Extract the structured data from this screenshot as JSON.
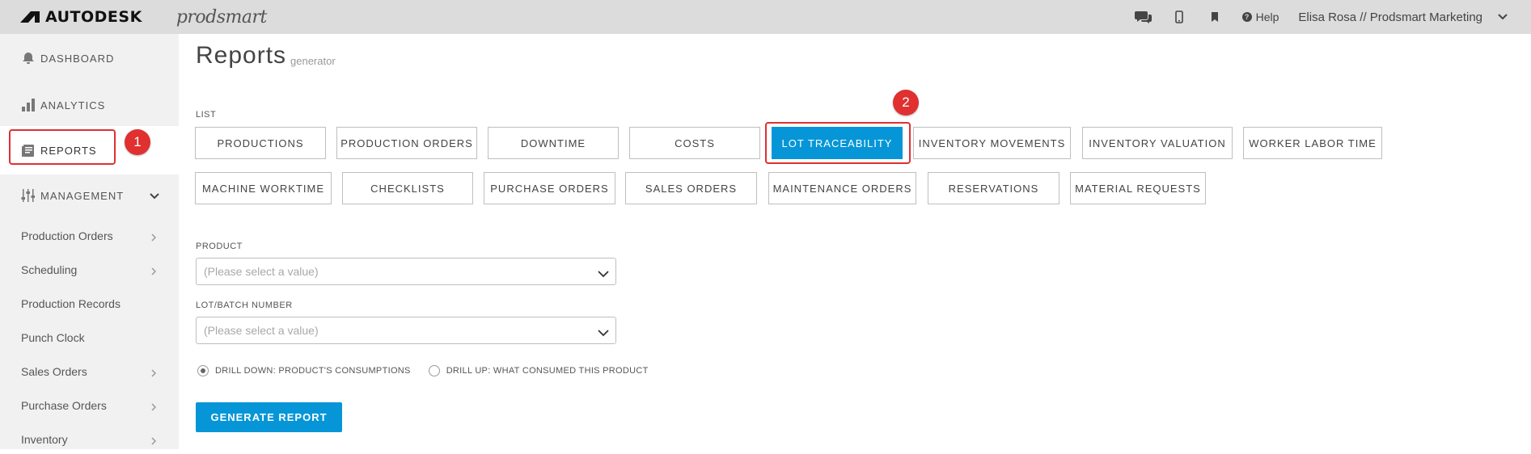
{
  "topbar": {
    "brand": "AUTODESK",
    "product": "prodsmart",
    "help": "Help",
    "user": "Elisa Rosa // Prodsmart Marketing"
  },
  "sidebar": {
    "dashboard": "DASHBOARD",
    "analytics": "ANALYTICS",
    "reports": "REPORTS",
    "management": "MANAGEMENT",
    "sub_items": [
      {
        "label": "Production Orders",
        "chevron": true
      },
      {
        "label": "Scheduling",
        "chevron": true
      },
      {
        "label": "Production Records",
        "chevron": false
      },
      {
        "label": "Punch Clock",
        "chevron": false
      },
      {
        "label": "Sales Orders",
        "chevron": true
      },
      {
        "label": "Purchase Orders",
        "chevron": true
      },
      {
        "label": "Inventory",
        "chevron": true
      }
    ]
  },
  "annotations": {
    "badge1": "1",
    "badge2": "2"
  },
  "main": {
    "title": "Reports",
    "subtitle": "generator",
    "list_label": "LIST",
    "row1": [
      "PRODUCTIONS",
      "PRODUCTION ORDERS",
      "DOWNTIME",
      "COSTS",
      "LOT TRACEABILITY",
      "INVENTORY MOVEMENTS",
      "INVENTORY VALUATION",
      "WORKER LABOR TIME"
    ],
    "row2": [
      "MACHINE WORKTIME",
      "CHECKLISTS",
      "PURCHASE ORDERS",
      "SALES ORDERS",
      "MAINTENANCE ORDERS",
      "RESERVATIONS",
      "MATERIAL REQUESTS"
    ],
    "active_report": "LOT TRACEABILITY",
    "product_label": "PRODUCT",
    "product_placeholder": "(Please select a value)",
    "lot_label": "LOT/BATCH NUMBER",
    "lot_placeholder": "(Please select a value)",
    "radio_down": "DRILL DOWN: PRODUCT'S CONSUMPTIONS",
    "radio_up": "DRILL UP: WHAT CONSUMED THIS PRODUCT",
    "radio_selected": "down",
    "generate_label": "GENERATE REPORT"
  },
  "colors": {
    "accent": "#0696d7",
    "highlight": "#e03030",
    "topbar_bg": "#dcdcdc",
    "sidebar_bg": "#f1f1f1"
  }
}
